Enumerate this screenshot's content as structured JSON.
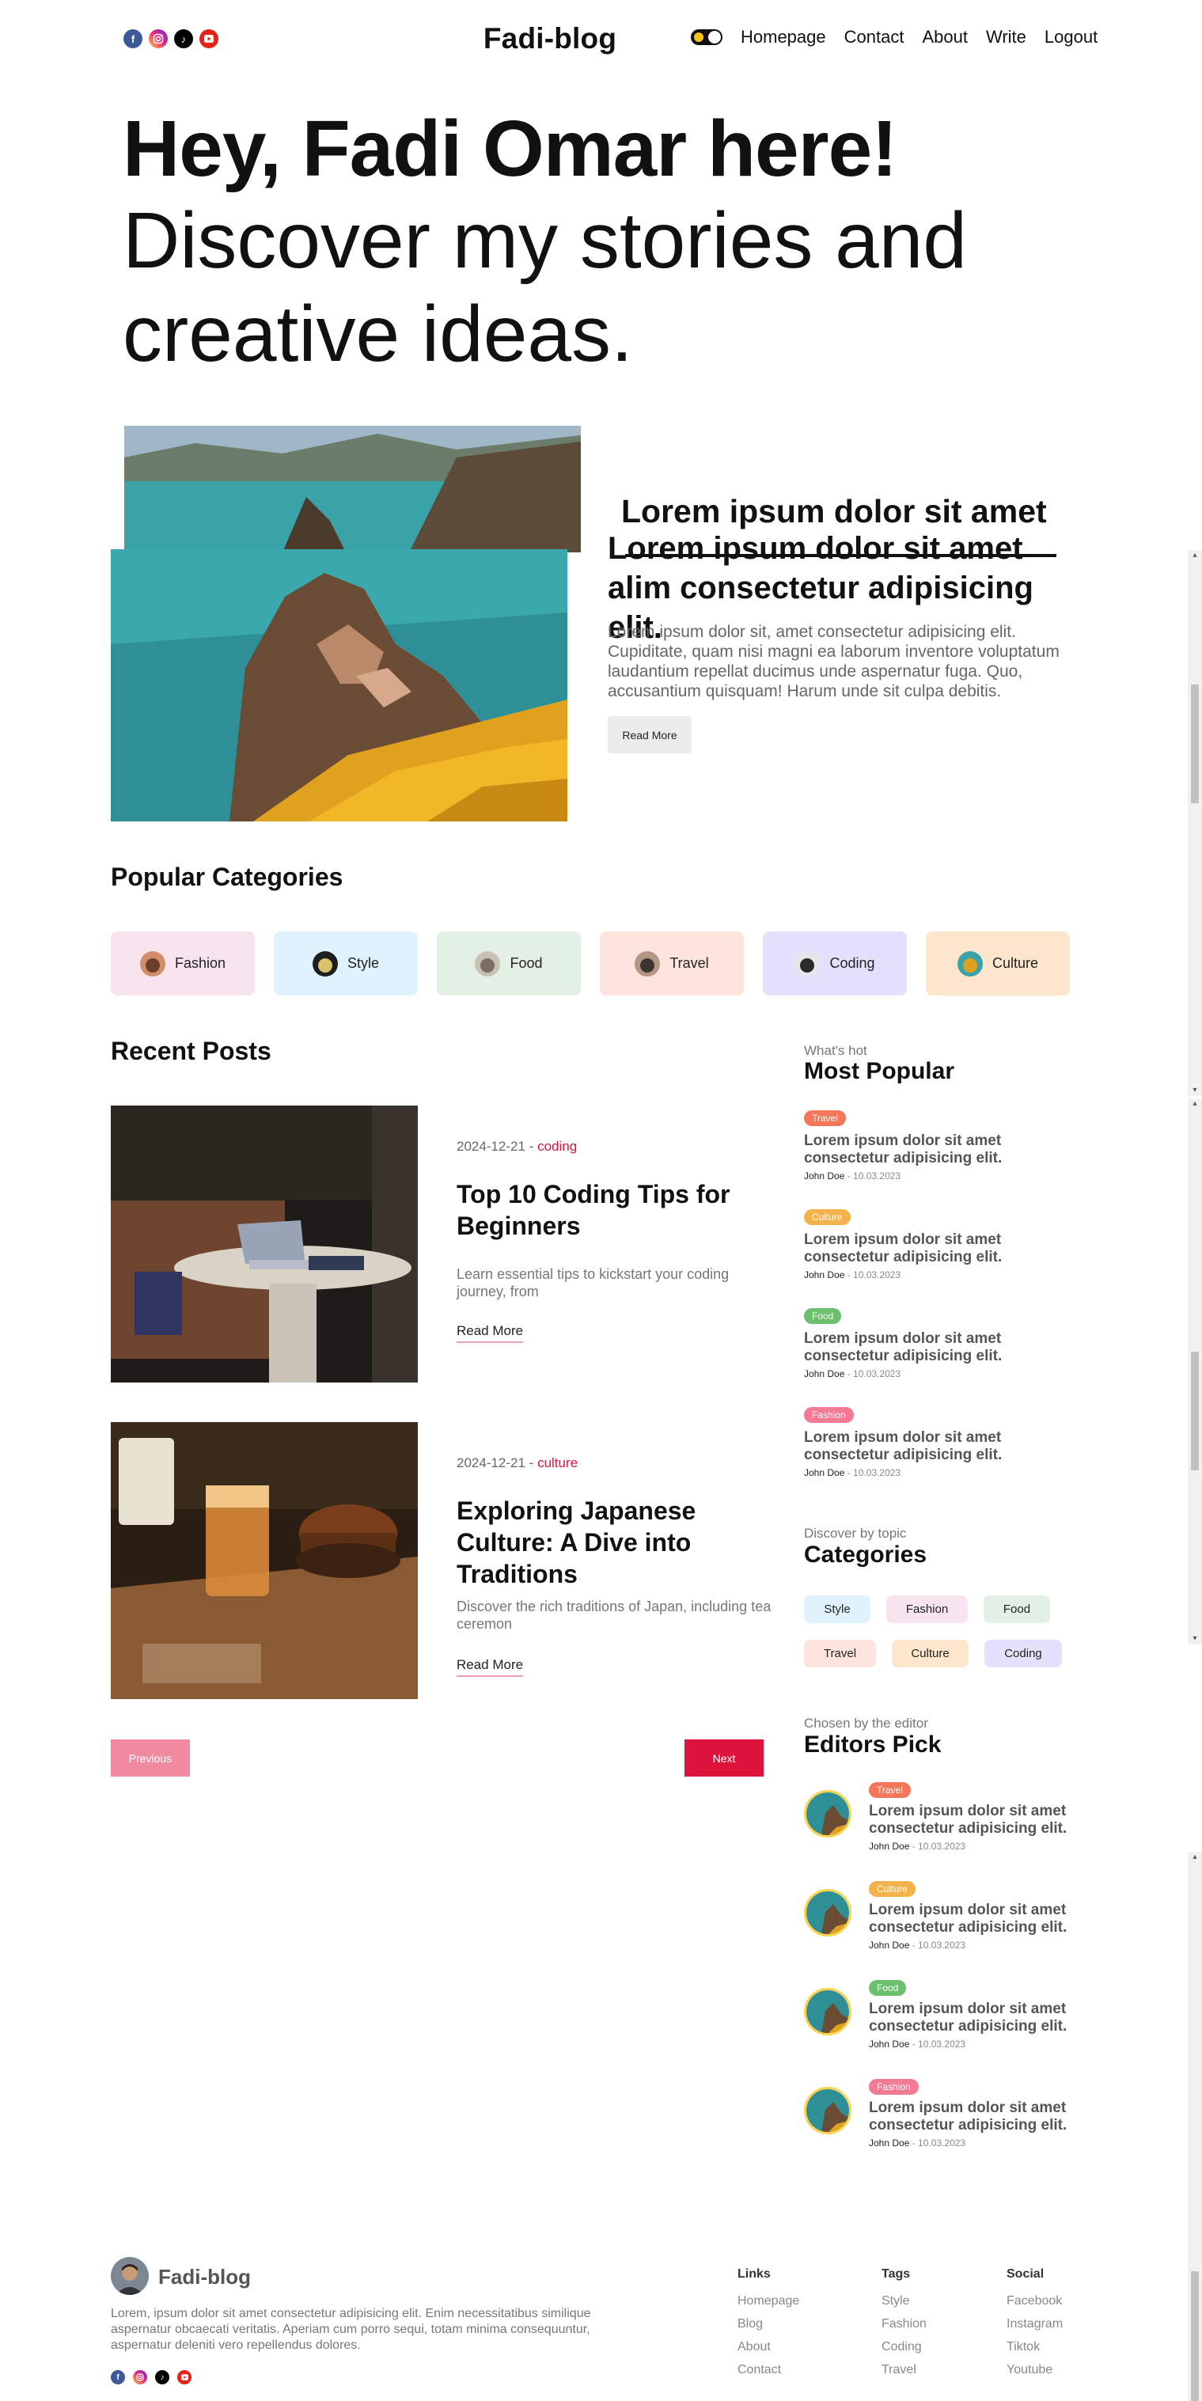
{
  "navbar": {
    "brand": "Fadi-blog",
    "links": [
      "Homepage",
      "Contact",
      "About",
      "Write",
      "Logout"
    ],
    "social_icons": [
      "facebook-icon",
      "instagram-icon",
      "tiktok-icon",
      "youtube-icon"
    ],
    "theme_toggle": "dark"
  },
  "hero": {
    "line1": "Hey, Fadi Omar here!",
    "line2": "Discover my stories and creative ideas."
  },
  "featured": {
    "title": "Lorem ipsum dolor sit amet alim consectetur adipisicing elit.",
    "description": "Lorem ipsum dolor sit, amet consectetur adipisicing elit. Cupiditate, quam nisi magni ea laborum inventore voluptatum laudantium repellat ducimus unde aspernatur fuga. Quo, accusantium quisquam! Harum unde sit culpa debitis.",
    "button": "Read More"
  },
  "popular_categories": {
    "title": "Popular Categories",
    "items": [
      {
        "label": "Fashion",
        "bg": "#f8e4ef"
      },
      {
        "label": "Style",
        "bg": "#e0f2fd"
      },
      {
        "label": "Food",
        "bg": "#e3f0e6"
      },
      {
        "label": "Travel",
        "bg": "#fde4dc"
      },
      {
        "label": "Coding",
        "bg": "#e3e1fb"
      },
      {
        "label": "Culture",
        "bg": "#fde6cb"
      }
    ]
  },
  "recent_posts": {
    "title": "Recent Posts",
    "posts": [
      {
        "date": "2024-12-21 - ",
        "category": "coding",
        "title": "Top 10 Coding Tips for Beginners",
        "description": "Learn essential tips to kickstart your coding journey, from",
        "link": "Read More"
      },
      {
        "date": "2024-12-21 - ",
        "category": "culture",
        "title": "Exploring Japanese Culture: A Dive into Traditions",
        "description": "Discover the rich traditions of Japan, including tea ceremon",
        "link": "Read More"
      }
    ],
    "prev": "Previous",
    "next": "Next"
  },
  "most_popular": {
    "subtitle": "What's hot",
    "title": "Most Popular",
    "items": [
      {
        "tag": "Travel",
        "tag_color": "#f4775b",
        "title": "Lorem ipsum dolor sit amet consectetur adipisicing elit.",
        "author": "John Doe",
        "date": " - 10.03.2023"
      },
      {
        "tag": "Culture",
        "tag_color": "#f4b34a",
        "title": "Lorem ipsum dolor sit amet consectetur adipisicing elit.",
        "author": "John Doe",
        "date": " - 10.03.2023"
      },
      {
        "tag": "Food",
        "tag_color": "#6cbf6c",
        "title": "Lorem ipsum dolor sit amet consectetur adipisicing elit.",
        "author": "John Doe",
        "date": " - 10.03.2023"
      },
      {
        "tag": "Fashion",
        "tag_color": "#f27a95",
        "title": "Lorem ipsum dolor sit amet consectetur adipisicing elit.",
        "author": "John Doe",
        "date": " - 10.03.2023"
      }
    ]
  },
  "categories": {
    "subtitle": "Discover by topic",
    "title": "Categories",
    "rows": [
      [
        {
          "label": "Style",
          "bg": "#e0f2fd"
        },
        {
          "label": "Fashion",
          "bg": "#f8e4ef"
        },
        {
          "label": "Food",
          "bg": "#e3f0e6"
        }
      ],
      [
        {
          "label": "Travel",
          "bg": "#fde4dc"
        },
        {
          "label": "Culture",
          "bg": "#fde6cb"
        },
        {
          "label": "Coding",
          "bg": "#e3e1fb"
        }
      ]
    ]
  },
  "editors_pick": {
    "subtitle": "Chosen by the editor",
    "title": "Editors Pick",
    "items": [
      {
        "tag": "Travel",
        "tag_color": "#f4775b",
        "title": "Lorem ipsum dolor sit amet consectetur adipisicing elit.",
        "author": "John Doe",
        "date": " - 10.03.2023"
      },
      {
        "tag": "Culture",
        "tag_color": "#f4b34a",
        "title": "Lorem ipsum dolor sit amet consectetur adipisicing elit.",
        "author": "John Doe",
        "date": " - 10.03.2023"
      },
      {
        "tag": "Food",
        "tag_color": "#6cbf6c",
        "title": "Lorem ipsum dolor sit amet consectetur adipisicing elit.",
        "author": "John Doe",
        "date": " - 10.03.2023"
      },
      {
        "tag": "Fashion",
        "tag_color": "#f27a95",
        "title": "Lorem ipsum dolor sit amet consectetur adipisicing elit.",
        "author": "John Doe",
        "date": " - 10.03.2023"
      }
    ]
  },
  "footer": {
    "brand": "Fadi-blog",
    "description": "Lorem, ipsum dolor sit amet consectetur adipisicing elit. Enim necessitatibus similique aspernatur obcaecati veritatis. Aperiam cum porro sequi, totam minima consequuntur, aspernatur deleniti vero repellendus dolores.",
    "columns": [
      {
        "heading": "Links",
        "items": [
          "Homepage",
          "Blog",
          "About",
          "Contact"
        ]
      },
      {
        "heading": "Tags",
        "items": [
          "Style",
          "Fashion",
          "Coding",
          "Travel"
        ]
      },
      {
        "heading": "Social",
        "items": [
          "Facebook",
          "Instagram",
          "Tiktok",
          "Youtube"
        ]
      }
    ]
  },
  "colors": {
    "accent": "#dc143c",
    "accent_light": "#f08aa0",
    "text": "#111111",
    "muted": "#777777"
  }
}
